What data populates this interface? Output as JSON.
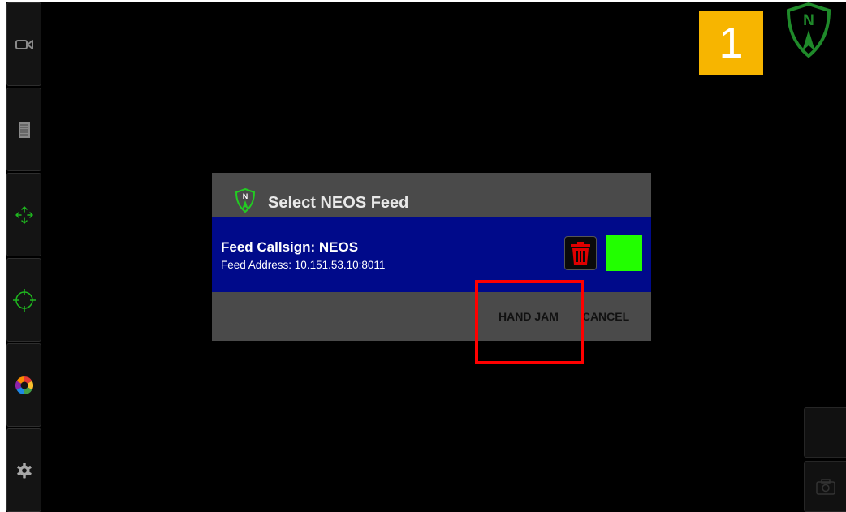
{
  "step_badge": {
    "number": "1"
  },
  "app_logo": {
    "letter": "N"
  },
  "toolbar": {
    "items": [
      {
        "icon": "video-camera-icon"
      },
      {
        "icon": "document-list-icon"
      },
      {
        "icon": "move-arrows-icon"
      },
      {
        "icon": "crosshair-icon"
      },
      {
        "icon": "color-wheel-icon"
      },
      {
        "icon": "gear-icon"
      }
    ]
  },
  "dialog": {
    "title": "Select NEOS Feed",
    "title_icon": "neos-shield-icon",
    "feed": {
      "callsign": "Feed Callsign: NEOS",
      "address": "Feed Address: 10.151.53.10:8011",
      "status_color": "#22ff00"
    },
    "buttons": {
      "hand_jam": "HAND JAM",
      "cancel": "CANCEL"
    }
  },
  "colors": {
    "accent_yellow": "#f7b500",
    "feed_row_blue": "#000a8a",
    "highlight_red": "#ff0000",
    "logo_green": "#1f8a2a"
  }
}
